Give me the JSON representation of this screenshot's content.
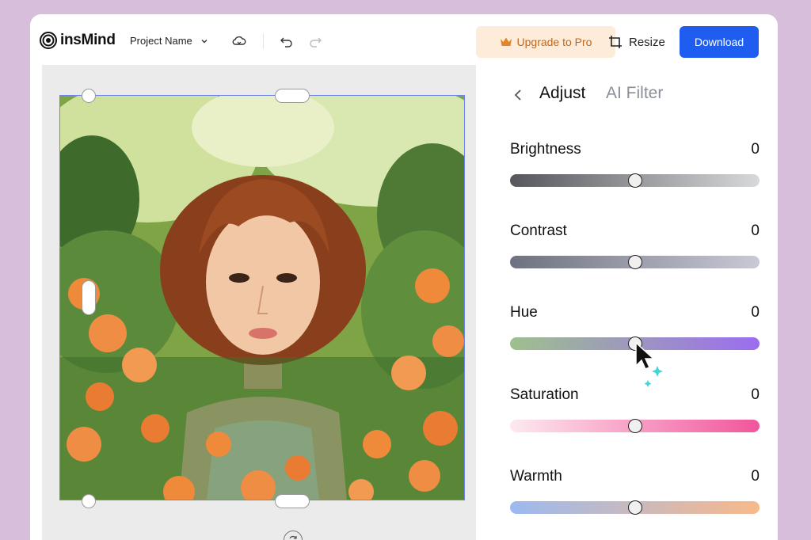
{
  "header": {
    "logo_text": "insMind",
    "project_name": "Project Name",
    "upgrade_label": "Upgrade to Pro",
    "resize_label": "Resize",
    "download_label": "Download"
  },
  "panel": {
    "tabs": [
      {
        "label": "Adjust",
        "active": true
      },
      {
        "label": "AI Filter",
        "active": false
      }
    ],
    "sliders": [
      {
        "label": "Brightness",
        "value": "0",
        "position": 0.5,
        "gradient": [
          "#55575c",
          "#d8d9db"
        ]
      },
      {
        "label": "Contrast",
        "value": "0",
        "position": 0.5,
        "gradient": [
          "#6e7180",
          "#c9c9d6"
        ]
      },
      {
        "label": "Hue",
        "value": "0",
        "position": 0.5,
        "gradient": [
          "#9ec08e",
          "#9b6df0"
        ]
      },
      {
        "label": "Saturation",
        "value": "0",
        "position": 0.5,
        "gradient": [
          "#fde9ef",
          "#f2559c"
        ]
      },
      {
        "label": "Warmth",
        "value": "0",
        "position": 0.5,
        "gradient": [
          "#9cb9f0",
          "#f8b98a"
        ]
      }
    ]
  },
  "colors": {
    "brand_blue": "#1f5df0",
    "upgrade_bg": "#fdecd9",
    "upgrade_text": "#c2671a",
    "selection_border": "#6d85e6"
  },
  "icons": [
    "logo-icon",
    "chevron-down-icon",
    "cloud-sync-icon",
    "undo-icon",
    "redo-icon",
    "crown-icon",
    "crop-icon",
    "back-chevron-icon",
    "rotate-icon",
    "cursor-icon",
    "sparkle-icon"
  ]
}
